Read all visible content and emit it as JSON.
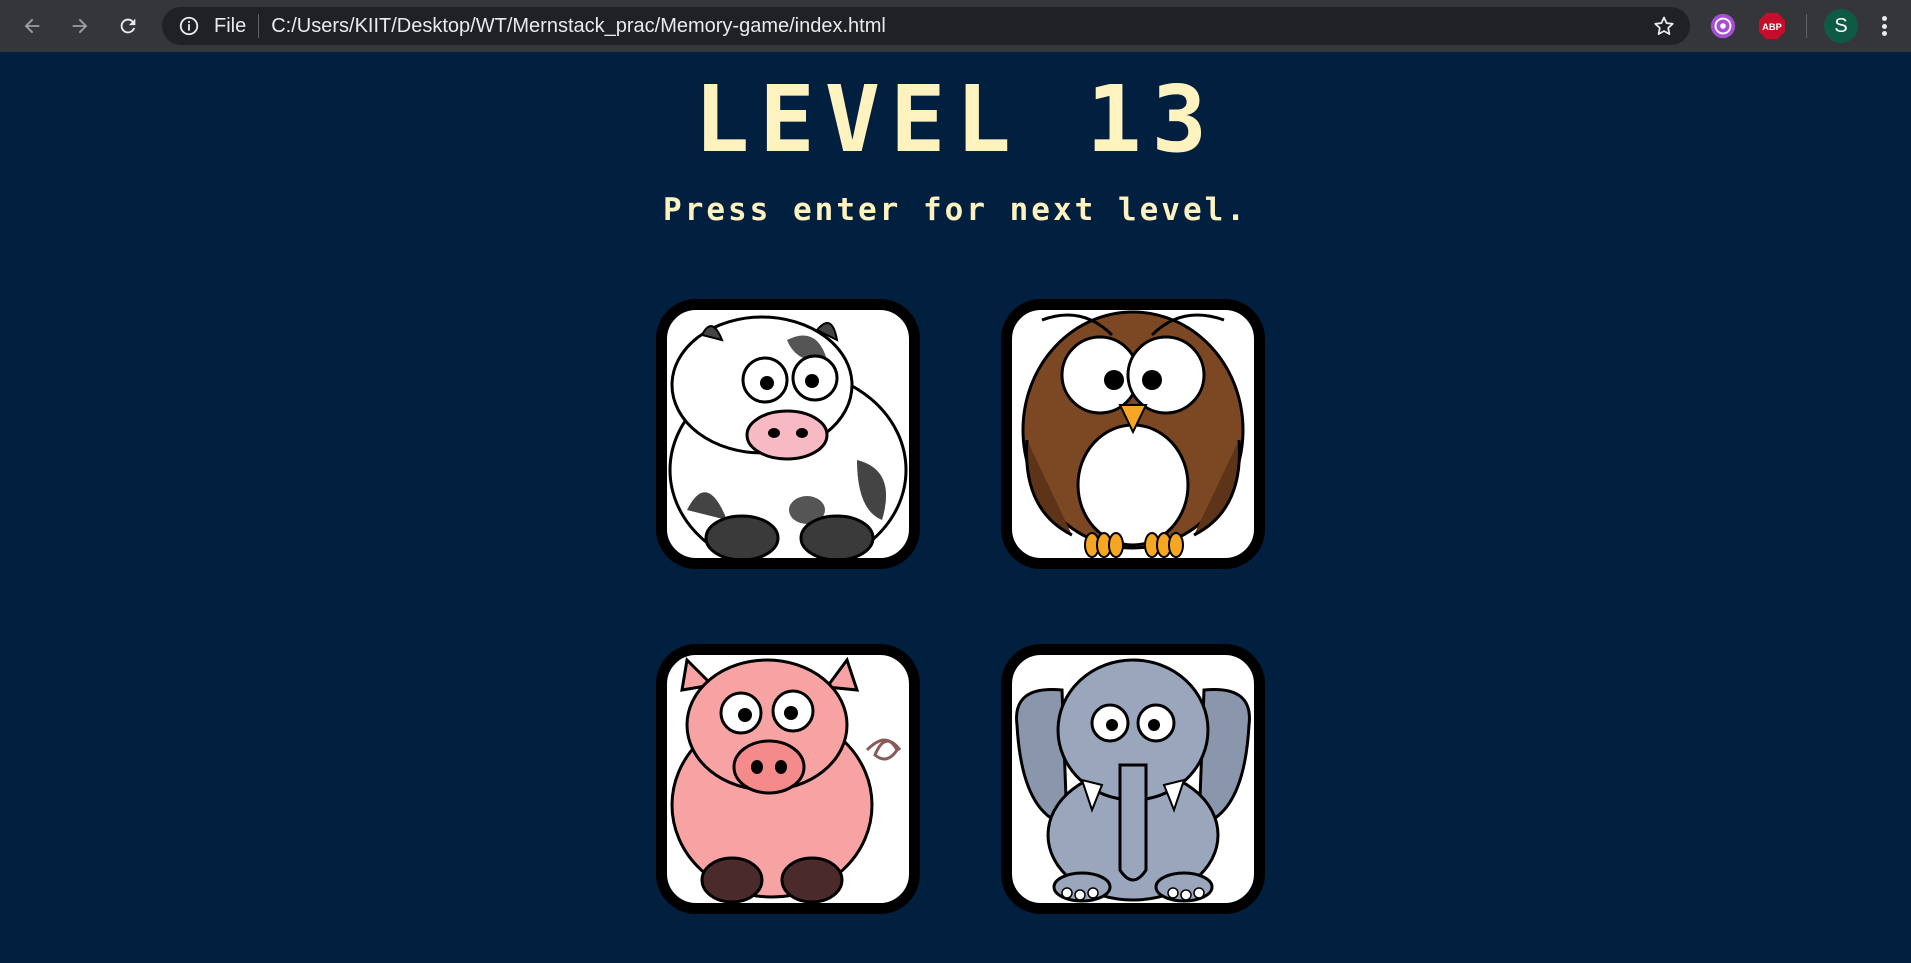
{
  "browser": {
    "scheme_label": "File",
    "url": "C:/Users/KIIT/Desktop/WT/Mernstack_prac/Memory-game/index.html",
    "abp_label": "ABP",
    "profile_initial": "S"
  },
  "game": {
    "title": "LEVEL 13",
    "subtitle": "Press enter for next level.",
    "cards": [
      {
        "animal": "cow"
      },
      {
        "animal": "owl"
      },
      {
        "animal": "pig"
      },
      {
        "animal": "elephant"
      }
    ]
  },
  "colors": {
    "background": "#011f3f",
    "title": "#fef2bf",
    "chrome": "#35363a",
    "omnibox": "#202124"
  }
}
